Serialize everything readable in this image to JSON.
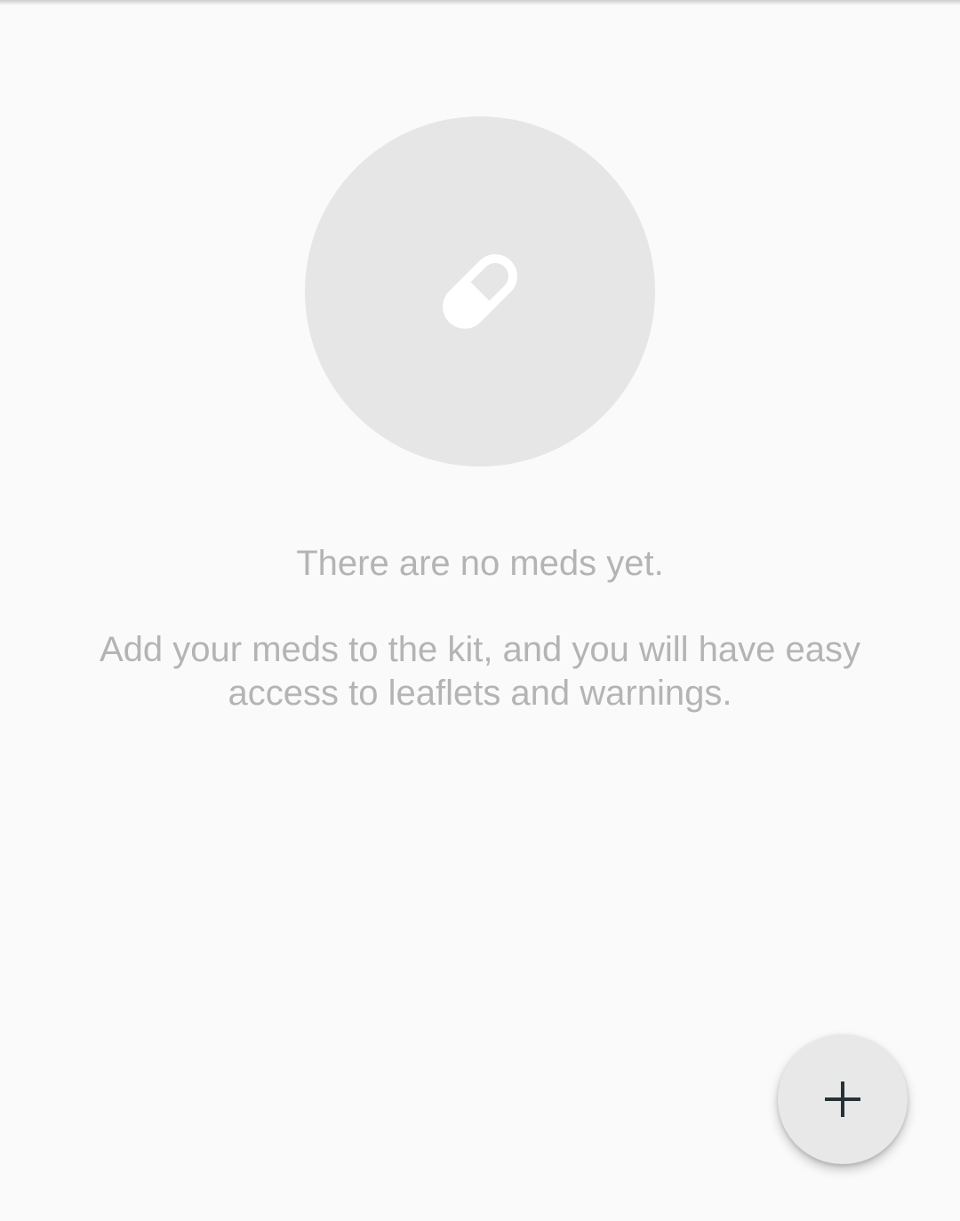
{
  "empty_state": {
    "icon": "pill-icon",
    "title": "There are no meds yet.",
    "description": "Add your meds to the kit, and you will have easy access to leaflets and warnings."
  },
  "fab": {
    "icon": "plus-icon"
  },
  "colors": {
    "background": "#fafafa",
    "circle": "#e6e6e6",
    "text": "#b4b4b4",
    "fab": "#e8e8e8",
    "fab_icon": "#263238"
  }
}
